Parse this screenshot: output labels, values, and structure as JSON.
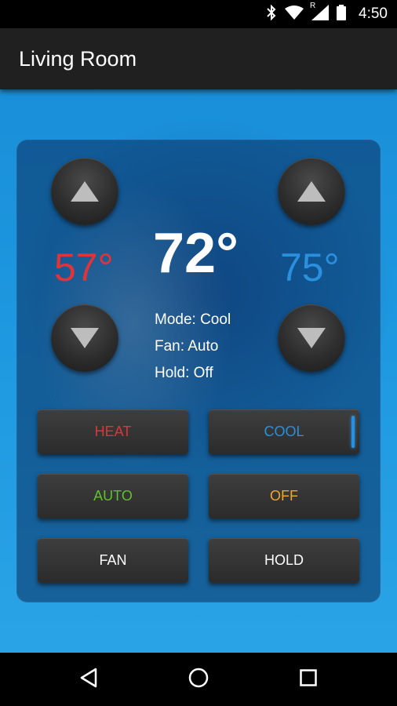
{
  "status_bar": {
    "time": "4:50",
    "icons": [
      "bluetooth-icon",
      "wifi-icon",
      "cell-signal-icon",
      "battery-icon"
    ],
    "cell_label": "R"
  },
  "app_bar": {
    "title": "Living Room"
  },
  "thermostat": {
    "heat_setpoint": "57°",
    "cool_setpoint": "75°",
    "current_temp": "72°",
    "mode_line": "Mode: Cool",
    "fan_line": "Fan: Auto",
    "hold_line": "Hold: Off"
  },
  "buttons": {
    "heat": "HEAT",
    "cool": "COOL",
    "auto": "AUTO",
    "off": "OFF",
    "fan": "FAN",
    "hold": "HOLD"
  },
  "colors": {
    "heat": "#e0333a",
    "cool": "#2a8fdc",
    "auto": "#5dc22a",
    "off": "#f0a428",
    "neutral": "#ffffff"
  },
  "selected_mode": "cool",
  "nav_bar": {
    "icons": [
      "back-icon",
      "home-icon",
      "recents-icon"
    ]
  }
}
